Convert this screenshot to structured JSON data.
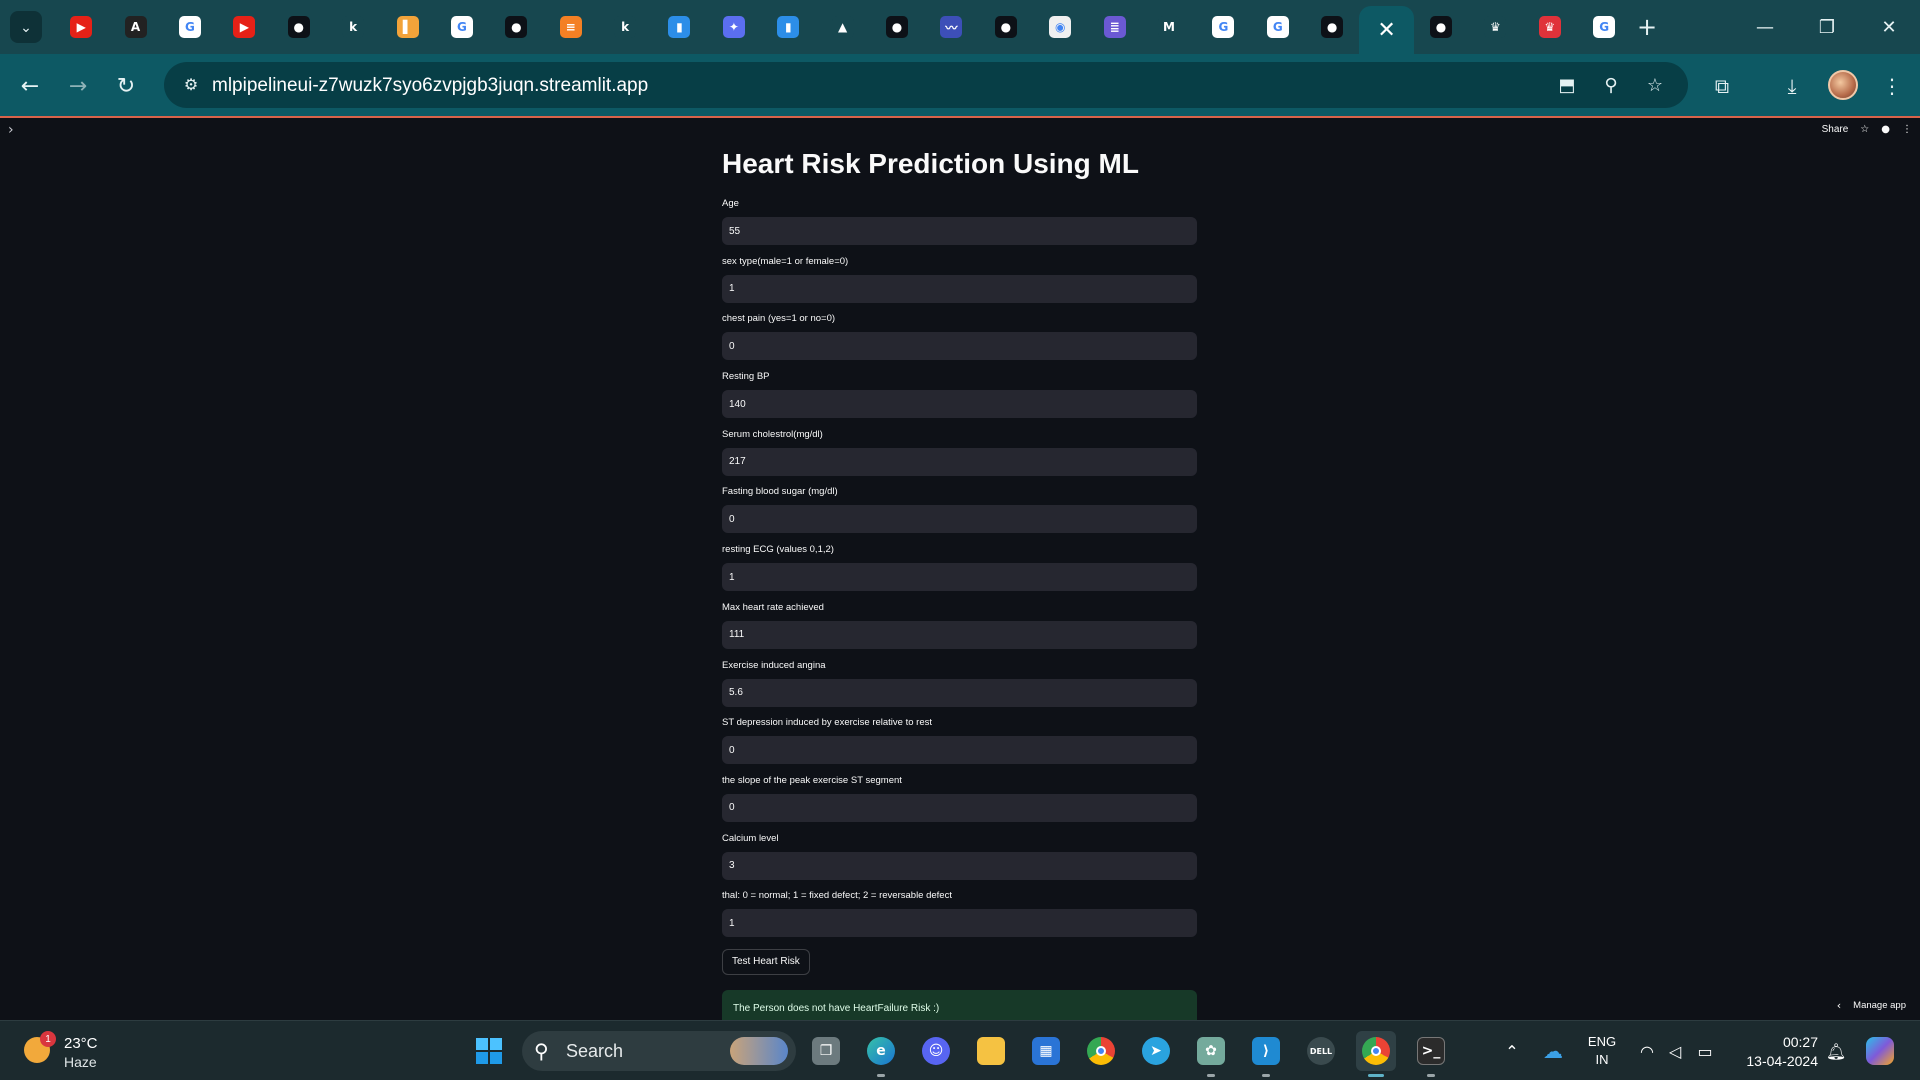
{
  "browser": {
    "tabs": [
      {
        "icon": "youtube-icon",
        "glyph": "▶",
        "color": "#e62117",
        "active": false
      },
      {
        "icon": "react-icon",
        "glyph": "A",
        "color": "#222222",
        "active": false
      },
      {
        "icon": "google-icon",
        "glyph": "G",
        "color": "#ffffff",
        "active": false
      },
      {
        "icon": "youtube-icon",
        "glyph": "▶",
        "color": "#e62117",
        "active": false
      },
      {
        "icon": "github-icon",
        "glyph": "●",
        "color": "#0d1117",
        "active": false
      },
      {
        "icon": "k-icon",
        "glyph": "k",
        "color": "#17474f",
        "active": false
      },
      {
        "icon": "bookmark-doc-icon",
        "glyph": "▌",
        "color": "#f2a33a",
        "active": false
      },
      {
        "icon": "google-icon",
        "glyph": "G",
        "color": "#ffffff",
        "active": false
      },
      {
        "icon": "github-icon",
        "glyph": "●",
        "color": "#0d1117",
        "active": false
      },
      {
        "icon": "stackoverflow-icon",
        "glyph": "≡",
        "color": "#f48024",
        "active": false
      },
      {
        "icon": "k-icon",
        "glyph": "k",
        "color": "#17474f",
        "active": false
      },
      {
        "icon": "blue-square-icon",
        "glyph": "▮",
        "color": "#2c8ee8",
        "active": false
      },
      {
        "icon": "figure-icon",
        "glyph": "✦",
        "color": "#5b6ef0",
        "active": false
      },
      {
        "icon": "blue-square-icon",
        "glyph": "▮",
        "color": "#2c8ee8",
        "active": false
      },
      {
        "icon": "google-drive-icon",
        "glyph": "▲",
        "color": "#17474f",
        "active": false
      },
      {
        "icon": "github-icon",
        "glyph": "●",
        "color": "#0d1117",
        "active": false
      },
      {
        "icon": "wave-icon",
        "glyph": "〰",
        "color": "#3d4fb8",
        "active": false
      },
      {
        "icon": "github-icon",
        "glyph": "●",
        "color": "#0d1117",
        "active": false
      },
      {
        "icon": "circuit-icon",
        "glyph": "◉",
        "color": "#f0f0f0",
        "active": false
      },
      {
        "icon": "list-icon",
        "glyph": "≣",
        "color": "#6b59d3",
        "active": false
      },
      {
        "icon": "gmail-icon",
        "glyph": "M",
        "color": "#17474f",
        "active": false
      },
      {
        "icon": "google-icon",
        "glyph": "G",
        "color": "#ffffff",
        "active": false
      },
      {
        "icon": "google-icon",
        "glyph": "G",
        "color": "#ffffff",
        "active": false
      },
      {
        "icon": "github-icon",
        "glyph": "●",
        "color": "#0d1117",
        "active": false
      },
      {
        "icon": "close-icon",
        "glyph": "✕",
        "color": "",
        "active": true
      },
      {
        "icon": "github-icon",
        "glyph": "●",
        "color": "#0d1117",
        "active": false
      },
      {
        "icon": "crown-icon",
        "glyph": "♛",
        "color": "#17474f",
        "active": false
      },
      {
        "icon": "red-crown-icon",
        "glyph": "♛",
        "color": "#e0323a",
        "active": false
      },
      {
        "icon": "google-icon",
        "glyph": "G",
        "color": "#ffffff",
        "active": false
      }
    ],
    "url": "mlpipelineui-z7wuzk7syo6zvpjgb3juqn.streamlit.app"
  },
  "app": {
    "header": {
      "share_label": "Share"
    },
    "title": "Heart Risk Prediction Using ML",
    "fields": [
      {
        "label": "Age",
        "value": "55"
      },
      {
        "label": "sex type(male=1 or female=0)",
        "value": "1"
      },
      {
        "label": "chest pain (yes=1 or no=0)",
        "value": "0"
      },
      {
        "label": "Resting BP",
        "value": "140"
      },
      {
        "label": "Serum cholestrol(mg/dl)",
        "value": "217"
      },
      {
        "label": "Fasting blood sugar (mg/dl)",
        "value": "0"
      },
      {
        "label": "resting ECG (values 0,1,2)",
        "value": "1"
      },
      {
        "label": "Max heart rate achieved",
        "value": "111"
      },
      {
        "label": "Exercise induced angina",
        "value": "5.6"
      },
      {
        "label": "ST depression induced by exercise relative to rest",
        "value": "0"
      },
      {
        "label": "the slope of the peak exercise ST segment",
        "value": "0"
      },
      {
        "label": "Calcium level",
        "value": "3"
      },
      {
        "label": "thal: 0 = normal; 1 = fixed defect; 2 = reversable defect",
        "value": "1"
      }
    ],
    "button_label": "Test Heart Risk",
    "result": "The Person does not have HeartFailure Risk :)",
    "manage_label": "Manage app"
  },
  "taskbar": {
    "weather": {
      "badge": "1",
      "temp": "23°C",
      "condition": "Haze"
    },
    "search_label": "Search",
    "lang_line1": "ENG",
    "lang_line2": "IN",
    "time": "00:27",
    "date": "13-04-2024"
  }
}
